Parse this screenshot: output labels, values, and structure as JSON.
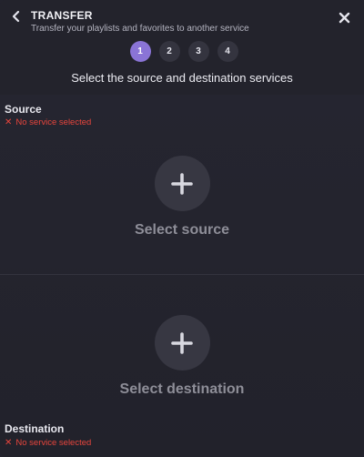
{
  "header": {
    "title": "TRANSFER",
    "subtitle": "Transfer your playlists and favorites to another service"
  },
  "steps": [
    {
      "label": "1",
      "active": true
    },
    {
      "label": "2",
      "active": false
    },
    {
      "label": "3",
      "active": false
    },
    {
      "label": "4",
      "active": false
    }
  ],
  "prompt": "Select the source and destination services",
  "source": {
    "label": "Source",
    "error": "No service selected",
    "picker_label": "Select source"
  },
  "destination": {
    "label": "Destination",
    "error": "No service selected",
    "picker_label": "Select destination"
  },
  "colors": {
    "accent": "#8a74d6",
    "error": "#e8453c",
    "background": "#24242e"
  },
  "icons": {
    "back": "chevron-left-icon",
    "close": "close-icon",
    "add": "plus-icon",
    "error": "x-mark-icon"
  }
}
